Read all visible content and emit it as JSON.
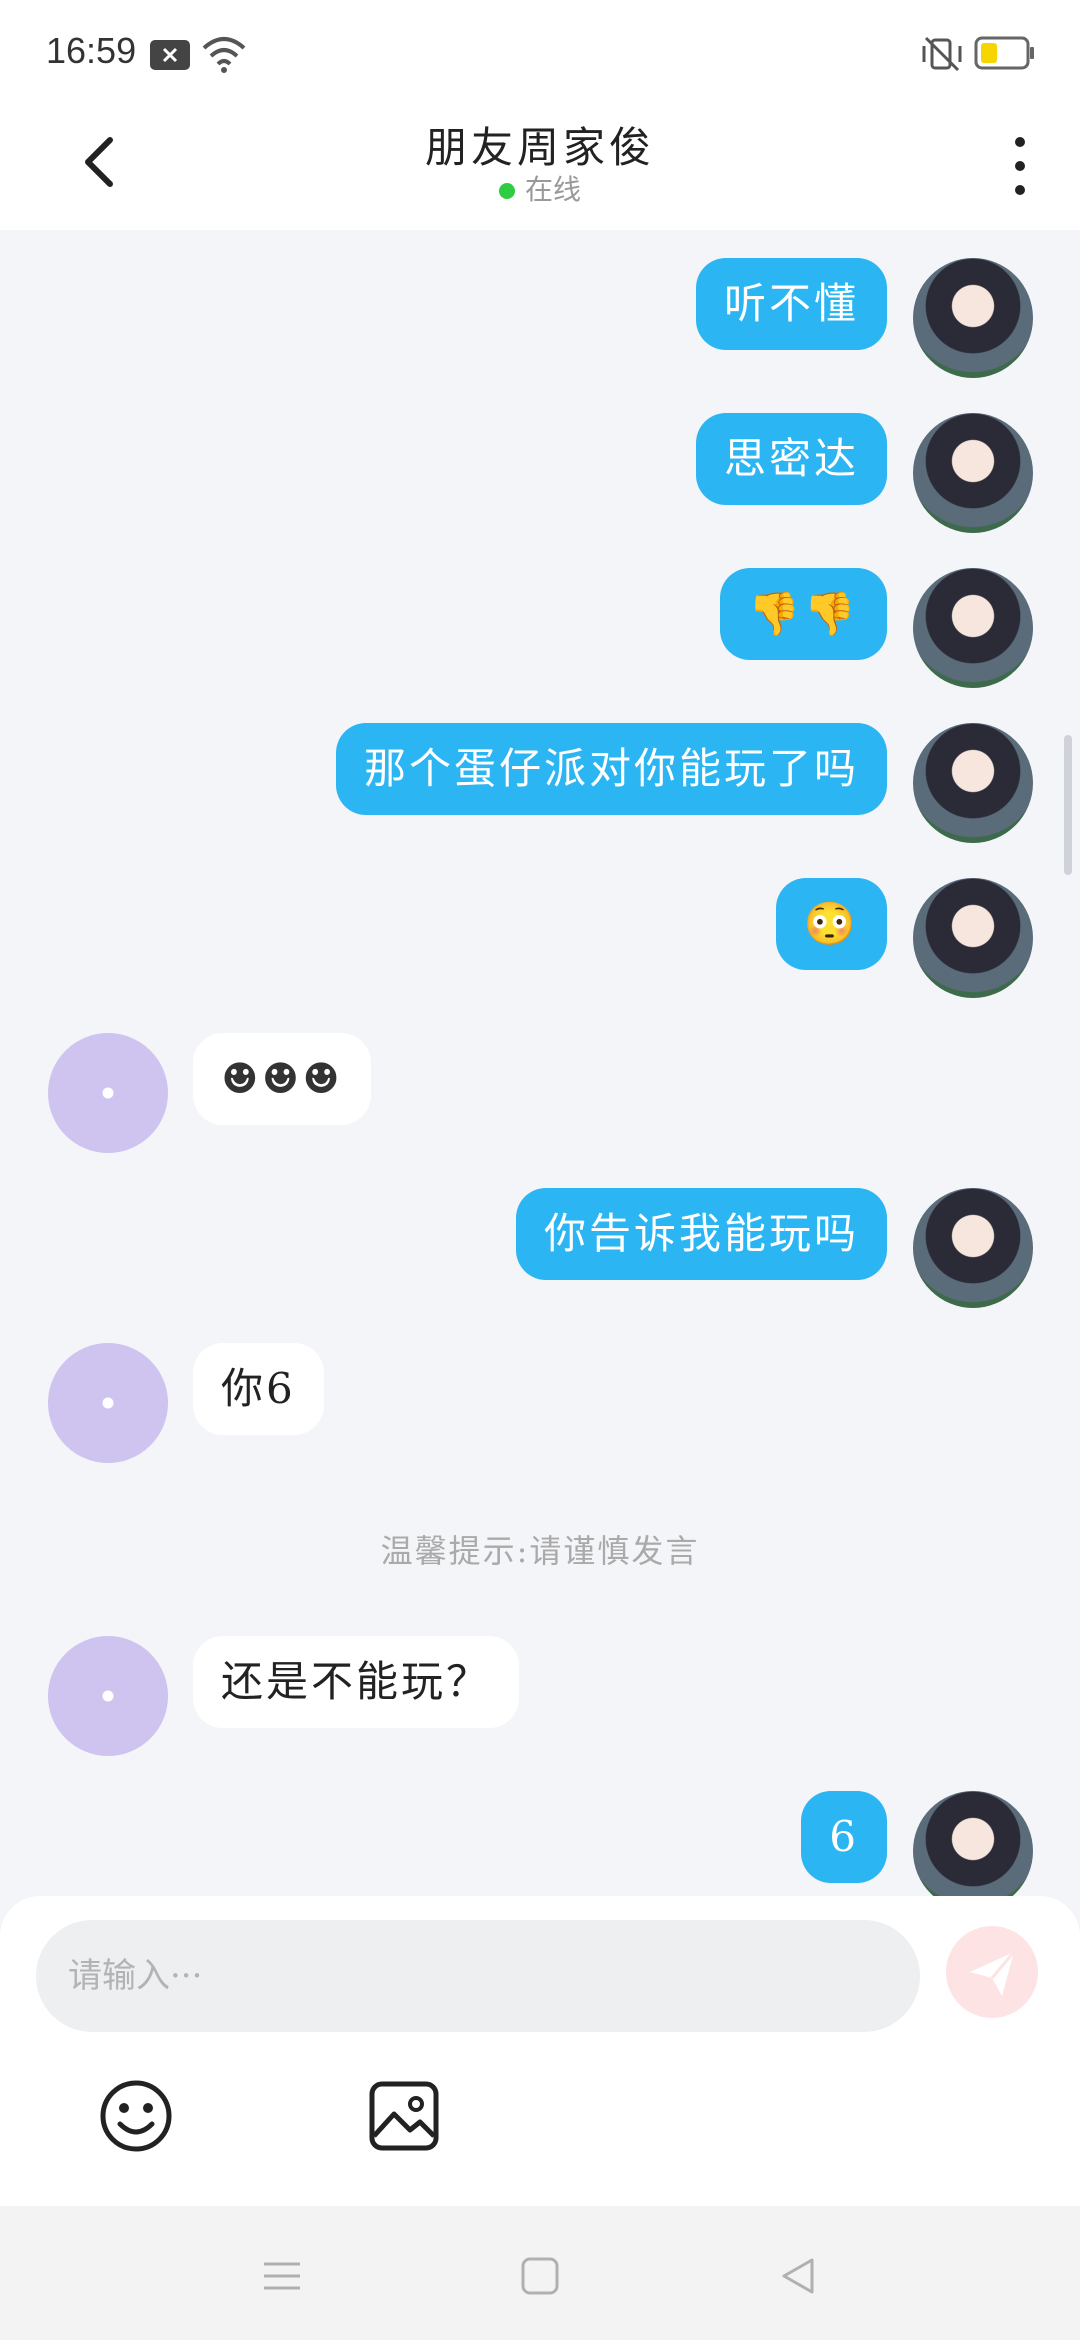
{
  "status_bar": {
    "time": "16:59"
  },
  "header": {
    "title": "朋友周家俊",
    "status": "在线"
  },
  "messages": [
    {
      "from": "me",
      "text": "听不懂"
    },
    {
      "from": "me",
      "text": "思密达"
    },
    {
      "from": "me",
      "text": "👎👎"
    },
    {
      "from": "me",
      "text": "那个蛋仔派对你能玩了吗"
    },
    {
      "from": "me",
      "text": "😳"
    },
    {
      "from": "other",
      "text": "☻☻☻"
    },
    {
      "from": "me",
      "text": "你告诉我能玩吗"
    },
    {
      "from": "other",
      "text": "你6"
    },
    {
      "from": "system",
      "text": "温馨提示:请谨慎发言"
    },
    {
      "from": "other",
      "text": "还是不能玩？"
    },
    {
      "from": "me",
      "text": "6"
    }
  ],
  "input": {
    "placeholder": "请输入···",
    "value": ""
  },
  "toolbar": {
    "emoji_icon": "smiley-icon",
    "image_icon": "image-icon",
    "send_icon": "paper-plane-icon"
  },
  "nav": {
    "menu_icon": "menu-icon",
    "home_icon": "home-square-icon",
    "back_icon": "back-triangle-icon"
  },
  "colors": {
    "my_bubble": "#2bb5f3",
    "other_bubble": "#ffffff",
    "online_dot": "#2ecc40",
    "background": "#f3f5f8"
  }
}
